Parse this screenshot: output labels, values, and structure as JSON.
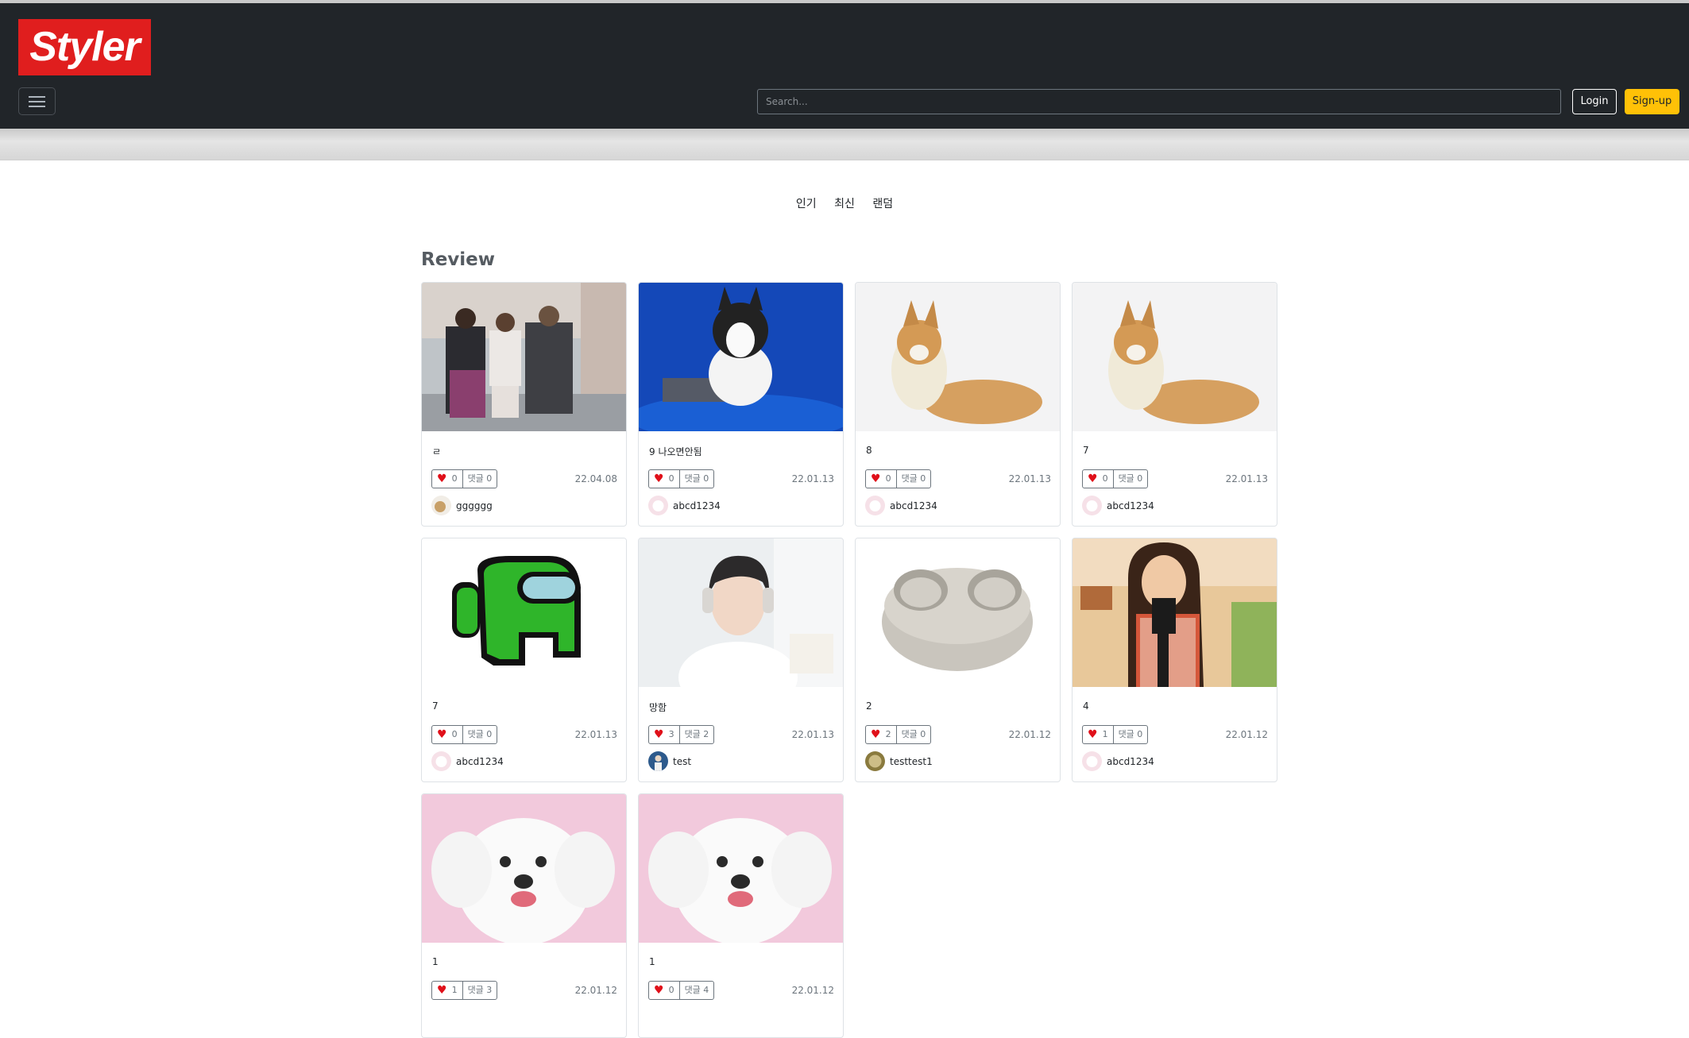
{
  "header": {
    "logo_text": "Styler",
    "search_placeholder": "Search...",
    "login_label": "Login",
    "signup_label": "Sign-up"
  },
  "sort_tabs": [
    "인기",
    "최신",
    "랜덤"
  ],
  "section_title": "Review",
  "cards": [
    {
      "title": "ㄹ",
      "likes": "0",
      "comments": "댓글 0",
      "date": "22.04.08",
      "author": "gggggg",
      "image": "street-fashion-photo",
      "avatar": "dog-avatar-icon"
    },
    {
      "title": "9 나오면안됨",
      "likes": "0",
      "comments": "댓글 0",
      "date": "22.01.13",
      "author": "abcd1234",
      "image": "husky-puppy-photo",
      "avatar": "white-dog-avatar-icon"
    },
    {
      "title": "8",
      "likes": "0",
      "comments": "댓글 0",
      "date": "22.01.13",
      "author": "abcd1234",
      "image": "corgi-photo",
      "avatar": "white-dog-avatar-icon"
    },
    {
      "title": "7",
      "likes": "0",
      "comments": "댓글 0",
      "date": "22.01.13",
      "author": "abcd1234",
      "image": "corgi-photo",
      "avatar": "white-dog-avatar-icon"
    },
    {
      "title": "7",
      "likes": "0",
      "comments": "댓글 0",
      "date": "22.01.13",
      "author": "abcd1234",
      "image": "green-crewmate-image",
      "avatar": "white-dog-avatar-icon"
    },
    {
      "title": "망함",
      "likes": "3",
      "comments": "댓글 2",
      "date": "22.01.13",
      "author": "test",
      "image": "man-headphones-photo",
      "avatar": "person-avatar-icon"
    },
    {
      "title": "2",
      "likes": "2",
      "comments": "댓글 0",
      "date": "22.01.12",
      "author": "testtest1",
      "image": "earbuds-case-photo",
      "avatar": "olive-avatar-icon"
    },
    {
      "title": "4",
      "likes": "1",
      "comments": "댓글 0",
      "date": "22.01.12",
      "author": "abcd1234",
      "image": "woman-camera-photo",
      "avatar": "white-dog-avatar-icon"
    },
    {
      "title": "1",
      "likes": "1",
      "comments": "댓글 3",
      "date": "22.01.12",
      "author": "",
      "image": "white-poodle-photo",
      "avatar": ""
    },
    {
      "title": "1",
      "likes": "0",
      "comments": "댓글 4",
      "date": "22.01.12",
      "author": "",
      "image": "white-poodle-photo",
      "avatar": ""
    }
  ],
  "colors": {
    "navbar": "#212529",
    "logo_bg": "#e01e1e",
    "signup_bg": "#ffc107",
    "heart": "#e0101a"
  }
}
